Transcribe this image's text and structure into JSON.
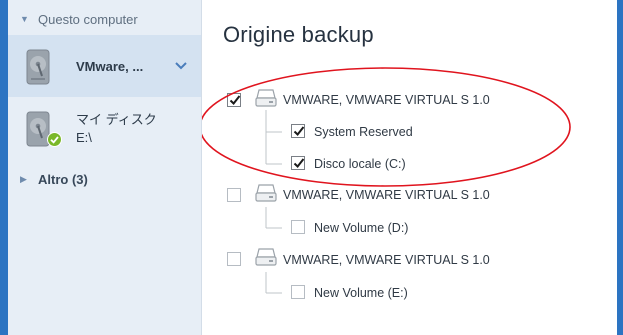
{
  "sidebar": {
    "group_computer": "Questo computer",
    "sources": [
      {
        "name": "VMware, ..."
      },
      {
        "name_line1": "マイ ディスク",
        "name_line2": "E:\\"
      }
    ],
    "group_other": "Altro (3)"
  },
  "main": {
    "title": "Origine backup",
    "disks": [
      {
        "label": "VMWARE, VMWARE VIRTUAL S 1.0",
        "checked": true,
        "partitions": [
          {
            "label": "System Reserved",
            "checked": true
          },
          {
            "label": "Disco locale (C:)",
            "checked": true
          }
        ]
      },
      {
        "label": "VMWARE, VMWARE VIRTUAL S 1.0",
        "checked": false,
        "partitions": [
          {
            "label": "New Volume (D:)",
            "checked": false
          }
        ]
      },
      {
        "label": "VMWARE, VMWARE VIRTUAL S 1.0",
        "checked": false,
        "partitions": [
          {
            "label": "New Volume (E:)",
            "checked": false
          }
        ]
      }
    ]
  },
  "colors": {
    "accent": "#2c74c2",
    "sidebar_bg": "#e7eef6",
    "selected_bg": "#d4e2f1",
    "highlight_ellipse": "#e0141e",
    "ok_green": "#7ab829"
  },
  "icons": [
    "expand-arrow-icon",
    "hard-drive-icon",
    "chevron-down-icon",
    "check-badge-icon",
    "collapse-arrow-icon",
    "disk-icon",
    "checkmark-icon"
  ]
}
